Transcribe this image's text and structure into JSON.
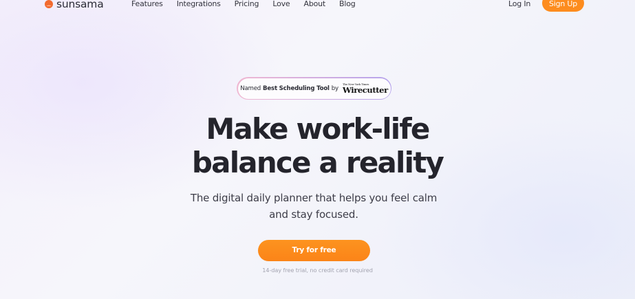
{
  "brand": {
    "name": "sunsama",
    "icon": "sunsama-logo-icon",
    "accent": "#fd8c1e"
  },
  "nav": {
    "links": [
      "Features",
      "Integrations",
      "Pricing",
      "Love",
      "About",
      "Blog"
    ],
    "login": "Log In",
    "signup": "Sign Up"
  },
  "award": {
    "prefix": "Named",
    "highlight": "Best Scheduling Tool",
    "by": "by",
    "publisher_small": "The New York Times",
    "publisher": "Wirecutter"
  },
  "hero": {
    "title_line1": "Make work-life",
    "title_line2": "balance a reality",
    "subtitle": "The digital daily planner that helps you feel calm and stay focused.",
    "cta": "Try for free",
    "note": "14-day free trial, no credit card required"
  }
}
